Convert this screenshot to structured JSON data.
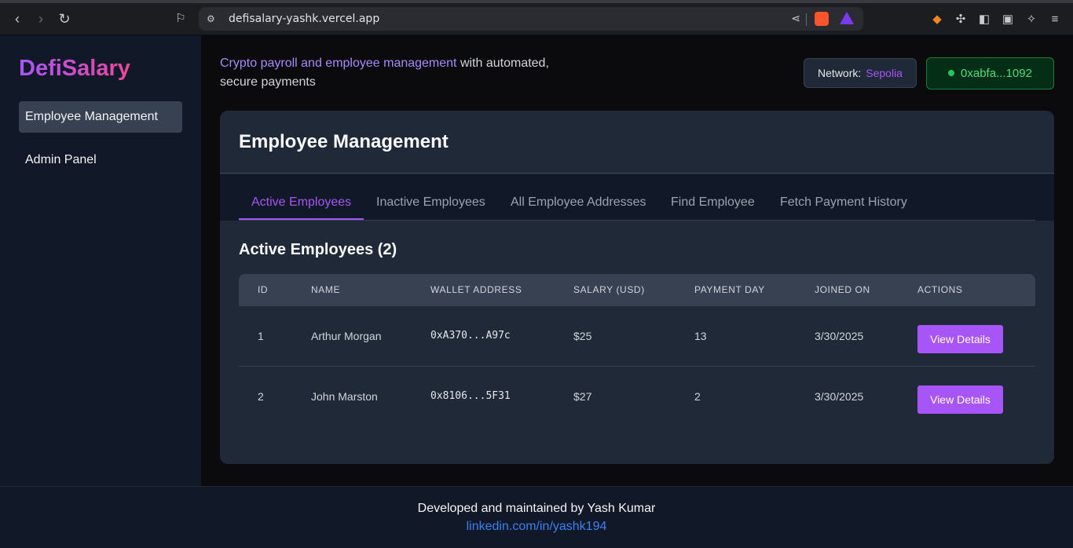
{
  "browser": {
    "url": "defisalary-yashk.vercel.app",
    "icons": [
      "back-icon",
      "forward-icon",
      "reload-icon",
      "bookmark-icon",
      "site-settings-icon",
      "share-icon",
      "brave-shield-icon",
      "brave-rewards-icon",
      "metamask-icon",
      "extensions-icon",
      "sidebar-icon",
      "wallet-icon",
      "leo-icon",
      "menu-icon"
    ]
  },
  "sidebar": {
    "logo": "DefiSalary",
    "items": [
      {
        "label": "Employee Management",
        "active": true
      },
      {
        "label": "Admin Panel",
        "active": false
      }
    ]
  },
  "header": {
    "tagline_highlight": "Crypto payroll and employee management",
    "tagline_rest": " with automated, secure payments",
    "network_label": "Network:",
    "network_value": "Sepolia",
    "wallet_address": "0xabfa...1092"
  },
  "card": {
    "title": "Employee Management",
    "tabs": [
      {
        "label": "Active Employees",
        "active": true
      },
      {
        "label": "Inactive Employees",
        "active": false
      },
      {
        "label": "All Employee Addresses",
        "active": false
      },
      {
        "label": "Find Employee",
        "active": false
      },
      {
        "label": "Fetch Payment History",
        "active": false
      }
    ],
    "section_title": "Active Employees (2)",
    "table": {
      "headers": [
        "ID",
        "NAME",
        "WALLET ADDRESS",
        "SALARY (USD)",
        "PAYMENT DAY",
        "JOINED ON",
        "ACTIONS"
      ],
      "rows": [
        {
          "id": "1",
          "name": "Arthur Morgan",
          "wallet": "0xA370...A97c",
          "salary": "$25",
          "payment_day": "13",
          "joined": "3/30/2025",
          "action": "View Details"
        },
        {
          "id": "2",
          "name": "John Marston",
          "wallet": "0x8106...5F31",
          "salary": "$27",
          "payment_day": "2",
          "joined": "3/30/2025",
          "action": "View Details"
        }
      ]
    }
  },
  "footer": {
    "line1": "Developed and maintained by Yash Kumar",
    "link": "linkedin.com/in/yashk194"
  },
  "colors": {
    "accent": "#a855f7",
    "wallet_green": "#4ade80",
    "link_blue": "#3b82f6"
  }
}
